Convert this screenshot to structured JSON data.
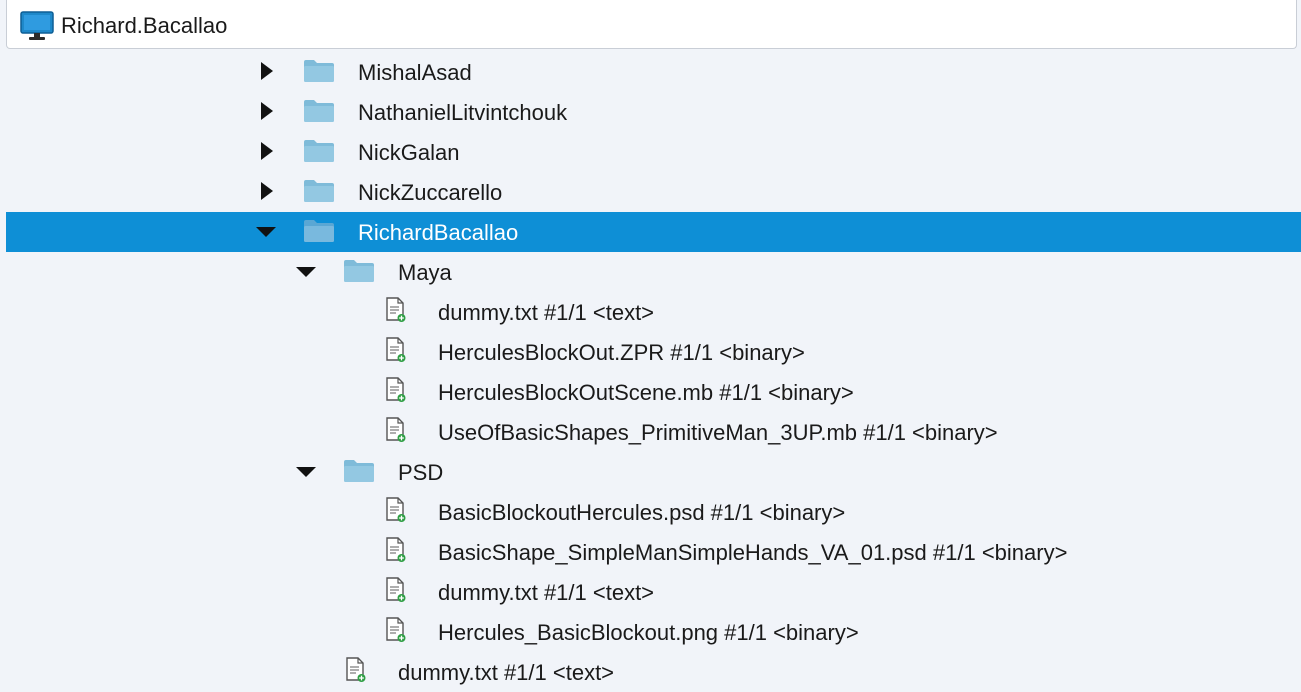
{
  "header": {
    "title": "Richard.Bacallao",
    "icon": "monitor-icon"
  },
  "colors": {
    "selection": "#0e8fd6",
    "folder": "#7fbbd9",
    "file_badge": "#2f9e44"
  },
  "tree": {
    "items": [
      {
        "label": "MishalAsad",
        "kind": "folder",
        "expanded": false
      },
      {
        "label": "NathanielLitvintchouk",
        "kind": "folder",
        "expanded": false
      },
      {
        "label": "NickGalan",
        "kind": "folder",
        "expanded": false
      },
      {
        "label": "NickZuccarello",
        "kind": "folder",
        "expanded": false
      },
      {
        "label": "RichardBacallao",
        "kind": "folder",
        "expanded": true,
        "selected": true
      },
      {
        "label": "Maya",
        "kind": "folder",
        "expanded": true
      },
      {
        "label": "dummy.txt #1/1 <text>",
        "kind": "file"
      },
      {
        "label": "HerculesBlockOut.ZPR #1/1 <binary>",
        "kind": "file"
      },
      {
        "label": "HerculesBlockOutScene.mb #1/1 <binary>",
        "kind": "file"
      },
      {
        "label": "UseOfBasicShapes_PrimitiveMan_3UP.mb #1/1 <binary>",
        "kind": "file"
      },
      {
        "label": "PSD",
        "kind": "folder",
        "expanded": true
      },
      {
        "label": "BasicBlockoutHercules.psd #1/1 <binary>",
        "kind": "file"
      },
      {
        "label": "BasicShape_SimpleManSimpleHands_VA_01.psd #1/1 <binary>",
        "kind": "file"
      },
      {
        "label": "dummy.txt #1/1 <text>",
        "kind": "file"
      },
      {
        "label": "Hercules_BasicBlockout.png #1/1 <binary>",
        "kind": "file"
      },
      {
        "label": "dummy.txt #1/1 <text>",
        "kind": "file"
      }
    ]
  }
}
